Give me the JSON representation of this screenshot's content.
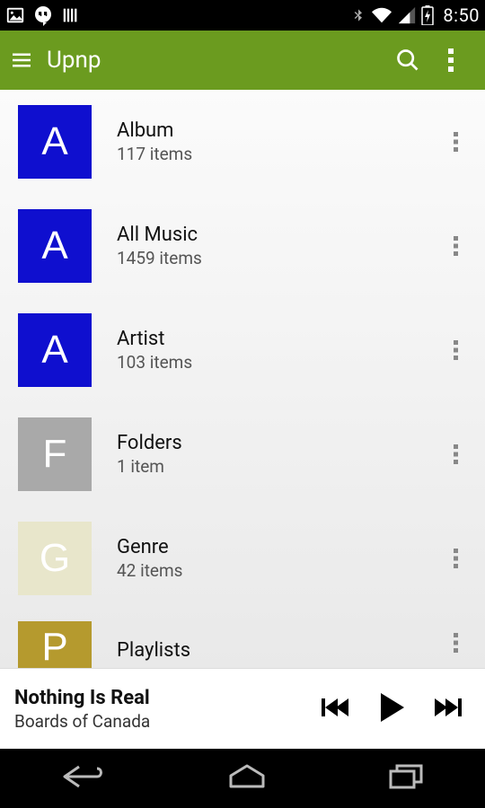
{
  "status_bar": {
    "clock": "8:50"
  },
  "app_bar": {
    "title": "Upnp"
  },
  "list": [
    {
      "letter": "A",
      "color": "#0f0fcf",
      "title": "Album",
      "subtitle": "117 items"
    },
    {
      "letter": "A",
      "color": "#0f0fcf",
      "title": "All Music",
      "subtitle": "1459 items"
    },
    {
      "letter": "A",
      "color": "#0f0fcf",
      "title": "Artist",
      "subtitle": "103 items"
    },
    {
      "letter": "F",
      "color": "#a9a9a9",
      "title": "Folders",
      "subtitle": "1 item"
    },
    {
      "letter": "G",
      "color": "#e8e6cb",
      "title": "Genre",
      "subtitle": "42 items"
    },
    {
      "letter": "P",
      "color": "#b59a2e",
      "title": "Playlists",
      "subtitle": ""
    }
  ],
  "now_playing": {
    "title": "Nothing Is Real",
    "artist": "Boards of Canada"
  }
}
